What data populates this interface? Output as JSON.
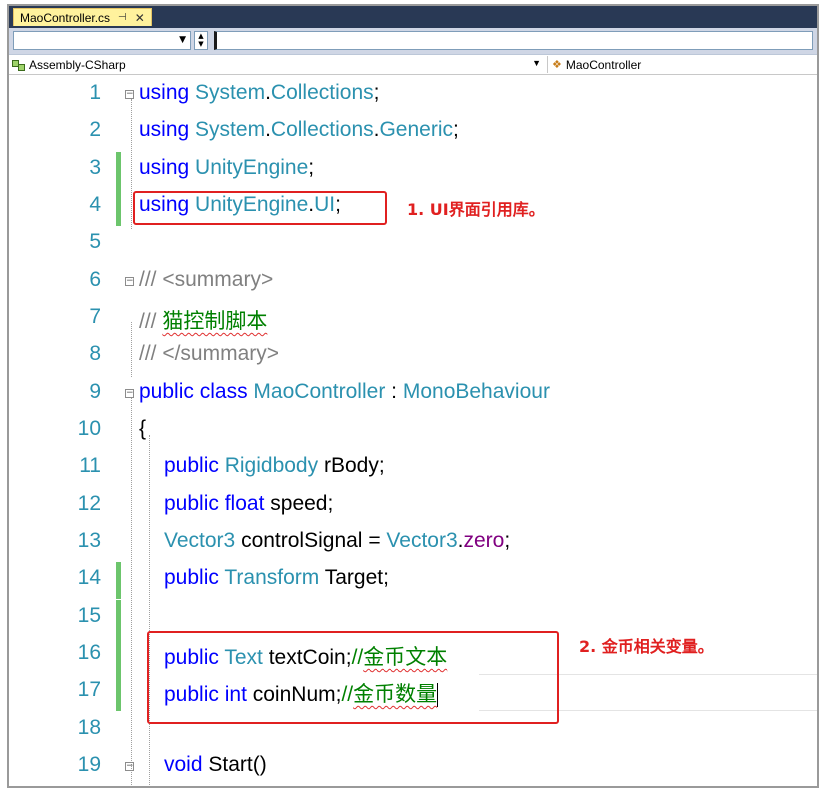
{
  "tab": {
    "filename": "MaoController.cs",
    "pin": "⊣",
    "close": "✕"
  },
  "nav": {
    "project": "Assembly-CSharp",
    "class": "MaoController"
  },
  "lines": [
    {
      "n": "1"
    },
    {
      "n": "2"
    },
    {
      "n": "3"
    },
    {
      "n": "4"
    },
    {
      "n": "5"
    },
    {
      "n": "6"
    },
    {
      "n": "7"
    },
    {
      "n": "8"
    },
    {
      "n": "9"
    },
    {
      "n": "10"
    },
    {
      "n": "11"
    },
    {
      "n": "12"
    },
    {
      "n": "13"
    },
    {
      "n": "14"
    },
    {
      "n": "15"
    },
    {
      "n": "16"
    },
    {
      "n": "17"
    },
    {
      "n": "18"
    },
    {
      "n": "19"
    }
  ],
  "code": {
    "using": "using",
    "sys": "System",
    "collections": "Collections",
    "generic": "Generic",
    "unityengine": "UnityEngine",
    "ui": "UI",
    "summary_open": "/// <summary>",
    "summary_prefix": "/// ",
    "summary_text": "猫控制脚本",
    "summary_close": "/// </summary>",
    "public": "public",
    "class": "class",
    "classname": "MaoController",
    "colon": ":",
    "monobehaviour": "MonoBehaviour",
    "brace": "{",
    "rigidbody": "Rigidbody",
    "rbody": "rBody;",
    "float": "float",
    "speed": "speed;",
    "vector3": "Vector3",
    "controlsignal": "controlSignal",
    "eq": "=",
    "zero": "zero",
    "transform": "Transform",
    "target": "Target;",
    "text": "Text",
    "textcoin": "textCoin;",
    "comment_prefix": "//",
    "comment_coin_text": "金币文本",
    "int": "int",
    "coinnum": "coinNum;",
    "comment_coin_num": "金币数量",
    "void": "void",
    "start": "Start",
    "parens": "()"
  },
  "annotations": {
    "note1": "1. UI界面引用库。",
    "note2": "2. 金币相关变量。"
  },
  "colors": {
    "keyword": "#0000ff",
    "type": "#2b91af",
    "comment": "#008000",
    "annotation": "#e02020",
    "tab": "#fff29d",
    "changed": "#6cc56c"
  }
}
